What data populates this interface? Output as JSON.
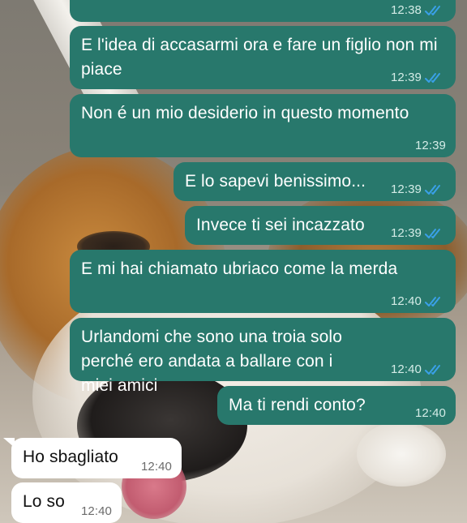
{
  "colors": {
    "outgoing_bubble": "#28786c",
    "incoming_bubble": "#ffffff",
    "read_ticks": "#3aa0e8"
  },
  "messages": [
    {
      "direction": "out",
      "text": "",
      "time": "12:38",
      "status": "read-ticks-icon"
    },
    {
      "direction": "out",
      "text": "E l'idea di accasarmi ora e fare un figlio non mi piace",
      "time": "12:39",
      "status": "read-ticks-icon"
    },
    {
      "direction": "out",
      "text": "Non é un mio desiderio in questo momento",
      "time": "12:39",
      "status": ""
    },
    {
      "direction": "out",
      "text": "E lo sapevi benissimo...",
      "time": "12:39",
      "status": "read-ticks-icon"
    },
    {
      "direction": "out",
      "text": "Invece ti sei incazzato",
      "time": "12:39",
      "status": "read-ticks-icon"
    },
    {
      "direction": "out",
      "text": "E mi hai chiamato ubriaco come la merda",
      "time": "12:40",
      "status": "read-ticks-icon"
    },
    {
      "direction": "out",
      "text": "Urlandomi che sono una troia solo perché ero andata a ballare con i miei amici",
      "time": "12:40",
      "status": "read-ticks-icon"
    },
    {
      "direction": "out",
      "text": "Ma ti rendi conto?",
      "time": "12:40",
      "status": ""
    },
    {
      "direction": "in",
      "text": "Ho sbagliato",
      "time": "12:40",
      "status": ""
    },
    {
      "direction": "in",
      "text": "Lo so",
      "time": "12:40",
      "status": ""
    }
  ]
}
